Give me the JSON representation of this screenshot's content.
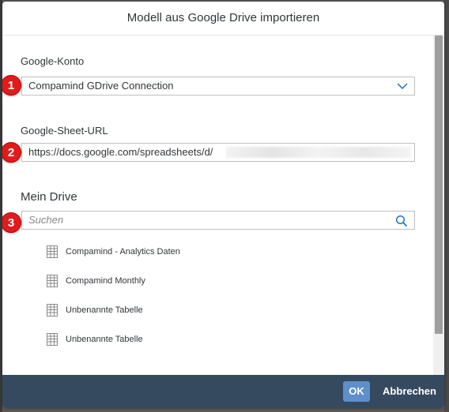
{
  "dialog": {
    "title": "Modell aus Google Drive importieren"
  },
  "account": {
    "label": "Google-Konto",
    "value": "Compamind GDrive Connection",
    "badge": "1"
  },
  "sheet_url": {
    "label": "Google-Sheet-URL",
    "value": "https://docs.google.com/spreadsheets/d/",
    "badge": "2"
  },
  "drive": {
    "title": "Mein Drive",
    "search_placeholder": "Suchen",
    "badge": "3",
    "items": [
      {
        "label": "Compamind - Analytics Daten",
        "icon": "spreadsheet-icon"
      },
      {
        "label": "Compamind Monthly",
        "icon": "spreadsheet-icon"
      },
      {
        "label": "Unbenannte Tabelle",
        "icon": "spreadsheet-icon"
      },
      {
        "label": "Unbenannte Tabelle",
        "icon": "spreadsheet-icon"
      }
    ]
  },
  "footer": {
    "ok_label": "OK",
    "cancel_label": "Abbrechen"
  },
  "colors": {
    "footer_bg": "#354a5f",
    "ok_bg": "#5e8fc9",
    "badge_red": "#e11b1b",
    "link_blue": "#0a6ed1"
  }
}
